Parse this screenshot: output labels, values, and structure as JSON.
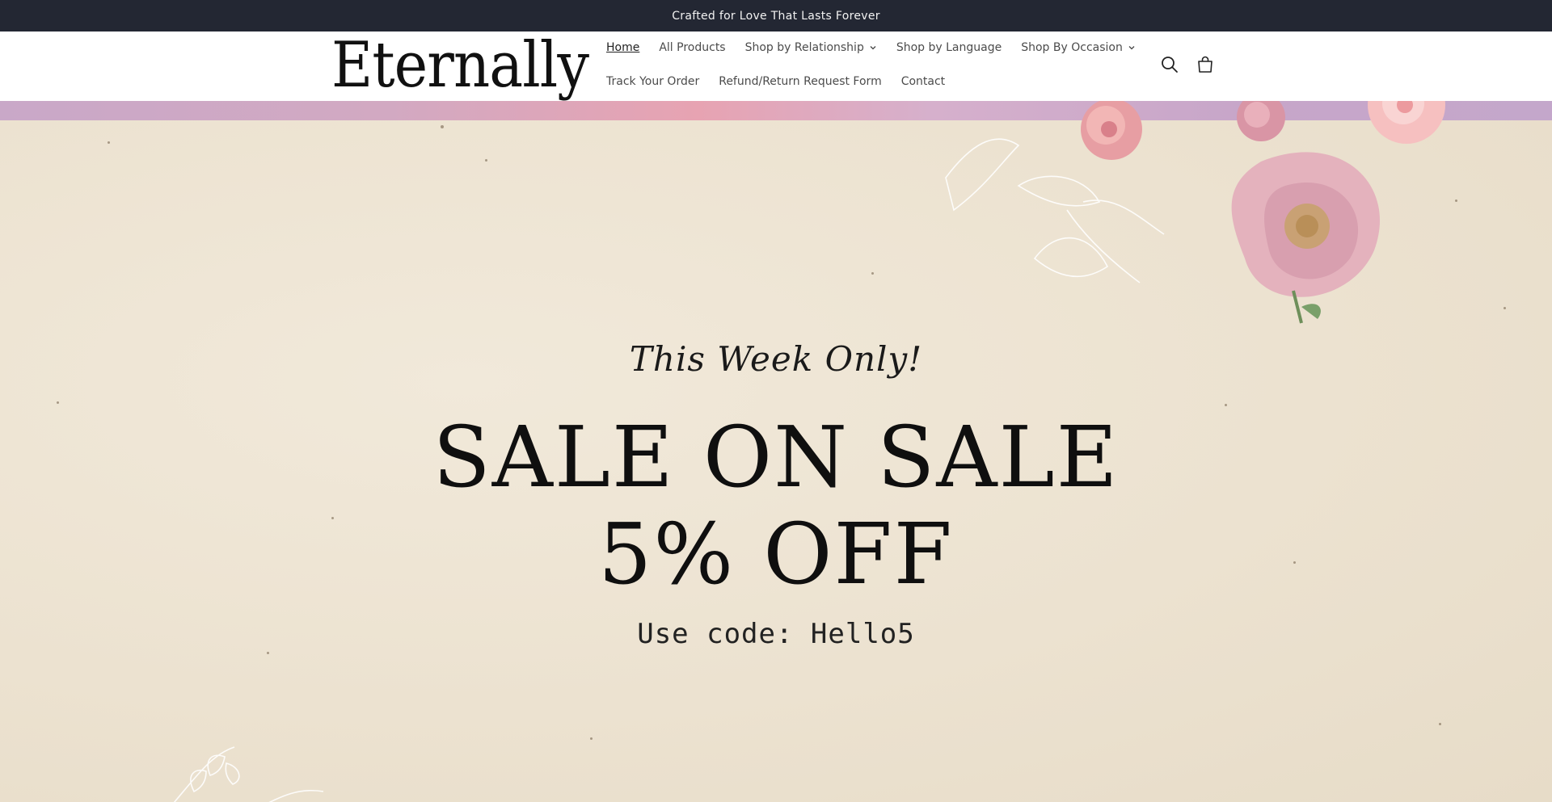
{
  "announcement": {
    "text": "Crafted for Love That Lasts Forever"
  },
  "header": {
    "logo_text": "Eternally",
    "nav_row1": [
      {
        "label": "Home",
        "active": true,
        "dropdown": false
      },
      {
        "label": "All Products",
        "active": false,
        "dropdown": false
      },
      {
        "label": "Shop by Relationship",
        "active": false,
        "dropdown": true
      },
      {
        "label": "Shop by Language",
        "active": false,
        "dropdown": false
      },
      {
        "label": "Shop By Occasion",
        "active": false,
        "dropdown": true
      }
    ],
    "nav_row2": [
      {
        "label": "Track Your Order"
      },
      {
        "label": "Refund/Return Request Form"
      },
      {
        "label": "Contact"
      }
    ],
    "icons": [
      "search-icon",
      "cart-icon"
    ]
  },
  "hero": {
    "tagline": "This Week Only!",
    "headline_line1": "SALE ON SALE",
    "headline_line2": "5% OFF",
    "code_text": "Use code: Hello5"
  },
  "colors": {
    "announcement_bg": "#232733",
    "hero_bg": "#efe6d6",
    "text_dark": "#0f0f0f"
  }
}
